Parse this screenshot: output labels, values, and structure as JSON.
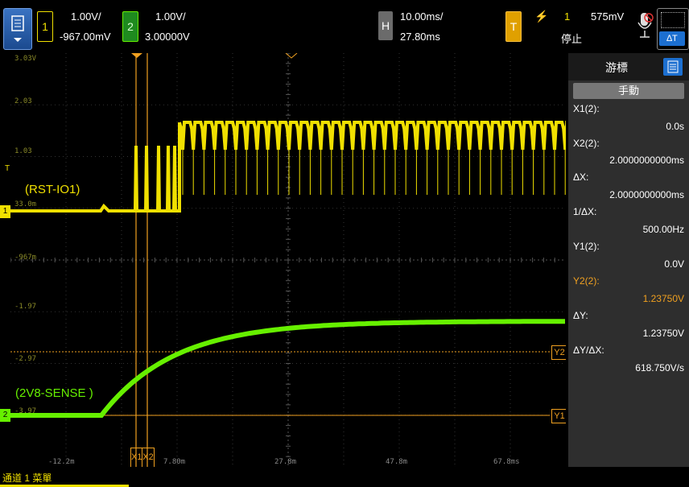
{
  "top": {
    "ch1": {
      "num": "1",
      "scale": "1.00V/",
      "offset": "-967.00mV"
    },
    "ch2": {
      "num": "2",
      "scale": "1.00V/",
      "offset": "3.00000V"
    },
    "horizontal": {
      "tag": "H",
      "scale": "10.00ms/",
      "delay": "27.80ms"
    },
    "trigger": {
      "tag": "T",
      "source": "1",
      "level": "575mV",
      "status": "停止"
    }
  },
  "graticule": {
    "yticks": [
      "3.03V",
      "2.03",
      "1.03",
      "33.0m",
      "-967m",
      "-1.97",
      "-2.97",
      "-3.97"
    ],
    "xticks": [
      "-12.2m",
      "7.80m",
      "27.8m",
      "47.8m",
      "67.8ms"
    ],
    "cursor_tags": {
      "x1": "X1",
      "x2": "X2",
      "y1": "Y1",
      "y2": "Y2"
    },
    "trig_marker": "T",
    "ch1_marker": "1",
    "ch2_marker": "2"
  },
  "labels": {
    "ch1": "(RST-IO1)",
    "ch2": "(2V8-SENSE )"
  },
  "panel": {
    "title": "游標",
    "mode": "手動",
    "rows": [
      {
        "label": "X1(2):",
        "value": "0.0s"
      },
      {
        "label": "X2(2):",
        "value": "2.0000000000ms"
      },
      {
        "label": "ΔX:",
        "value": "2.0000000000ms"
      },
      {
        "label": "1/ΔX:",
        "value": "500.00Hz"
      },
      {
        "label": "Y1(2):",
        "value": "0.0V"
      },
      {
        "label": "Y2(2):",
        "value": "1.23750V"
      },
      {
        "label": "ΔY:",
        "value": "1.23750V"
      },
      {
        "label": "ΔY/ΔX:",
        "value": "618.750V/s"
      }
    ]
  },
  "status": "通道 1 菜單",
  "colors": {
    "ch1": "#f0e000",
    "ch2": "#66f000",
    "cursor": "#f0a020",
    "panel": "#2e2e2e"
  }
}
